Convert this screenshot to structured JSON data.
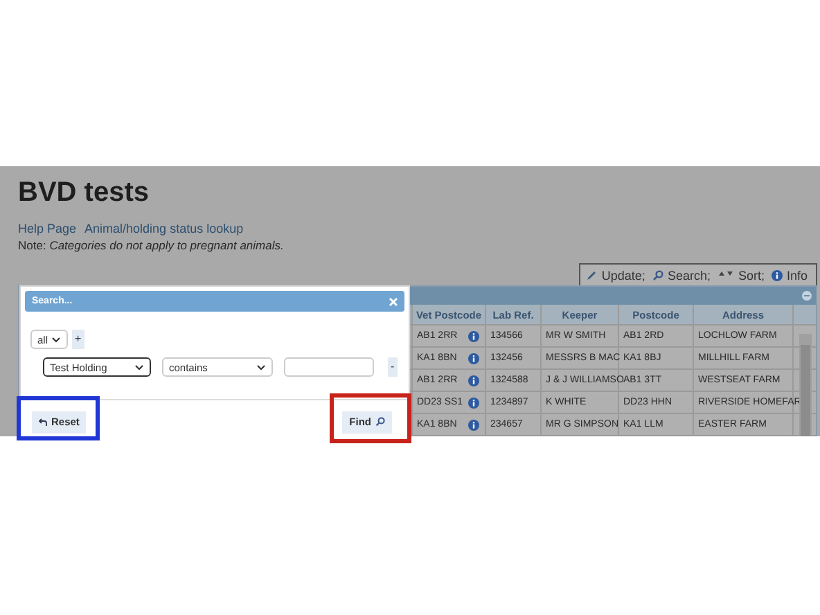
{
  "page": {
    "title": "BVD tests",
    "links": [
      "Help Page",
      "Animal/holding status lookup"
    ],
    "note": "Note: *Categories do not apply to pregnant animals.*"
  },
  "toolbar": [
    {
      "kind": "edit",
      "label": "Update;"
    },
    {
      "kind": "search",
      "label": "Search;"
    },
    {
      "kind": "sort",
      "label": "Sort;"
    },
    {
      "kind": "info",
      "label": "Info"
    }
  ],
  "grid": {
    "columns": [
      "Vet Postcode",
      "Lab Ref.",
      "Keeper",
      "Postcode",
      "Address"
    ],
    "rows": [
      [
        "AB1 2RR",
        "134566",
        "MR W SMITH",
        "AB1 2RD",
        "LOCHLOW FARM"
      ],
      [
        "KA1 8BN",
        "132456",
        "MESSRS B MAC",
        "KA1 8BJ",
        "MILLHILL FARM"
      ],
      [
        "AB1 2RR",
        "1324588",
        "J & J WILLIAMSO",
        "AB1 3TT",
        "WESTSEAT FARM"
      ],
      [
        "DD23 SS1",
        "1234897",
        "K WHITE",
        "DD23 HHN",
        "RIVERSIDE HOMEFAR"
      ],
      [
        "KA1 8BN",
        "234657",
        "MR G SIMPSON",
        "KA1 LLM",
        "EASTER FARM"
      ]
    ]
  },
  "dialog": {
    "title": "Search...",
    "match": "all",
    "add_button": "+",
    "rule": {
      "field": "Test Holding",
      "operator": "contains",
      "remove_button": "-"
    },
    "reset_button": "Reset",
    "find_button": "Find"
  },
  "highlights": [
    {
      "color": "#2037d6"
    },
    {
      "color": "#c8231b"
    }
  ]
}
